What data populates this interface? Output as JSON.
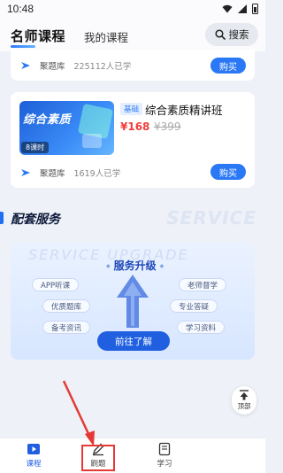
{
  "status_bar": {
    "time": "10:48"
  },
  "top_nav": {
    "tab_active": "名师课程",
    "tab_inactive": "我的课程",
    "search_label": "搜索"
  },
  "card_top": {
    "source": "聚题库",
    "students": "225112人已学",
    "buy_label": "购买"
  },
  "course": {
    "thumb_title": "综合素质",
    "lesson_count": "8课时",
    "tag": "基础",
    "title": "综合素质精讲班",
    "price_now": "¥168",
    "price_old": "¥399",
    "source": "聚题库",
    "students": "1619人已学",
    "buy_label": "购买"
  },
  "section": {
    "title": "配套服务",
    "watermark": "SERVICE"
  },
  "service": {
    "watermark": "SERVICE UPGRADE",
    "heading": "服务升级",
    "pills": [
      "APP听课",
      "优质题库",
      "备考资讯",
      "老师督学",
      "专业答疑",
      "学习资料"
    ],
    "cta": "前往了解"
  },
  "back_top_label": "顶部",
  "bottom_nav": {
    "items": [
      {
        "label": "课程",
        "icon": "play-icon",
        "active": true
      },
      {
        "label": "刷题",
        "icon": "pencil-icon",
        "active": false
      },
      {
        "label": "学习",
        "icon": "study-book-icon",
        "active": false
      }
    ]
  },
  "colors": {
    "accent": "#2a78f5",
    "price": "#f23c3c",
    "annotation": "#e53935"
  }
}
